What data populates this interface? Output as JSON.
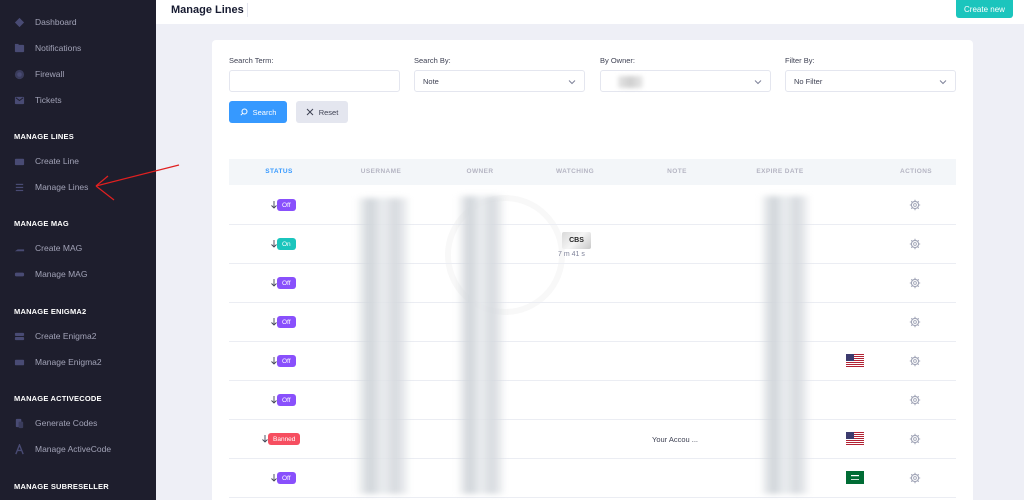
{
  "sidebar": {
    "items": [
      {
        "label": "Dashboard",
        "icon": "dashboard-icon"
      },
      {
        "label": "Notifications",
        "icon": "bell-icon"
      },
      {
        "label": "Firewall",
        "icon": "firewall-icon"
      },
      {
        "label": "Tickets",
        "icon": "ticket-icon"
      }
    ],
    "sections": [
      {
        "title": "MANAGE LINES",
        "items": [
          {
            "label": "Create Line"
          },
          {
            "label": "Manage Lines"
          }
        ]
      },
      {
        "title": "MANAGE MAG",
        "items": [
          {
            "label": "Create MAG"
          },
          {
            "label": "Manage MAG"
          }
        ]
      },
      {
        "title": "MANAGE ENIGMA2",
        "items": [
          {
            "label": "Create Enigma2"
          },
          {
            "label": "Manage Enigma2"
          }
        ]
      },
      {
        "title": "MANAGE ACTIVECODE",
        "items": [
          {
            "label": "Generate Codes"
          },
          {
            "label": "Manage ActiveCode"
          }
        ]
      },
      {
        "title": "MANAGE SUBRESELLER",
        "items": []
      }
    ]
  },
  "header": {
    "title": "Manage Lines",
    "create_button": "Create new"
  },
  "filters": {
    "search_term_label": "Search Term:",
    "search_term_value": "",
    "search_by_label": "Search By:",
    "search_by_value": "Note",
    "owner_label": "By Owner:",
    "filter_by_label": "Filter By:",
    "filter_by_value": "No Filter",
    "search_button": "Search",
    "reset_button": "Reset"
  },
  "table": {
    "columns": [
      "STATUS",
      "USERNAME",
      "OWNER",
      "WATCHING",
      "NOTE",
      "EXPIRE DATE",
      "ACTIONS"
    ],
    "rows": [
      {
        "status": "Off",
        "watching": "",
        "watch_time": "",
        "note": "",
        "flag": ""
      },
      {
        "status": "On",
        "watching": "CBS",
        "watch_time": "7 m 41 s",
        "note": "",
        "flag": ""
      },
      {
        "status": "Off",
        "watching": "",
        "watch_time": "",
        "note": "",
        "flag": ""
      },
      {
        "status": "Off",
        "watching": "",
        "watch_time": "",
        "note": "",
        "flag": ""
      },
      {
        "status": "Off",
        "watching": "",
        "watch_time": "",
        "note": "",
        "flag": "us"
      },
      {
        "status": "Off",
        "watching": "",
        "watch_time": "",
        "note": "",
        "flag": ""
      },
      {
        "status": "Banned",
        "watching": "",
        "watch_time": "",
        "note": "Your Accou ...",
        "flag": "us"
      },
      {
        "status": "Off",
        "watching": "",
        "watch_time": "",
        "note": "",
        "flag": "sa"
      }
    ]
  },
  "colors": {
    "sidebar_bg": "#1e1e2d",
    "primary": "#3699ff",
    "success": "#1bc5bd",
    "off_badge": "#8950fc",
    "banned_badge": "#f64e60"
  }
}
